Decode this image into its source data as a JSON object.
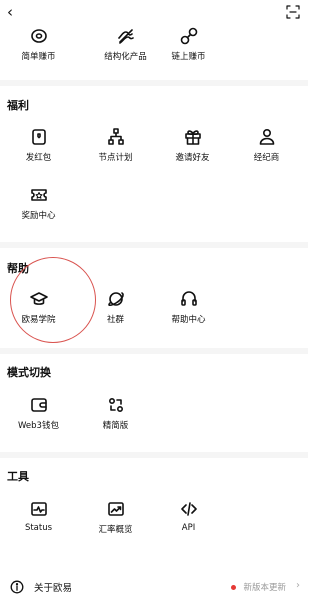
{
  "header": {
    "back_icon": "back-arrow-icon",
    "scan_icon": "scan-icon"
  },
  "top_items": [
    {
      "label": "简单赚币",
      "icon": "coin-target-icon"
    },
    {
      "label": "结构化产品",
      "icon": "structured-icon"
    },
    {
      "label": "链上赚币",
      "icon": "chain-icon"
    }
  ],
  "welfare": {
    "title": "福利",
    "items": [
      {
        "label": "发红包",
        "icon": "red-packet-icon"
      },
      {
        "label": "节点计划",
        "icon": "node-plan-icon"
      },
      {
        "label": "邀请好友",
        "icon": "gift-icon"
      },
      {
        "label": "经纪商",
        "icon": "broker-icon"
      },
      {
        "label": "奖励中心",
        "icon": "ticket-icon"
      }
    ]
  },
  "help": {
    "title": "帮助",
    "items": [
      {
        "label": "欧易学院",
        "icon": "graduation-cap-icon"
      },
      {
        "label": "社群",
        "icon": "planet-icon"
      },
      {
        "label": "帮助中心",
        "icon": "headset-icon"
      }
    ]
  },
  "mode": {
    "title": "模式切换",
    "items": [
      {
        "label": "Web3钱包",
        "icon": "wallet-icon"
      },
      {
        "label": "精简版",
        "icon": "switch-icon"
      }
    ]
  },
  "tools": {
    "title": "工具",
    "items": [
      {
        "label": "Status",
        "icon": "status-icon"
      },
      {
        "label": "汇率概览",
        "icon": "exchange-rate-icon"
      },
      {
        "label": "API",
        "icon": "code-icon"
      }
    ]
  },
  "about": {
    "label": "关于欧易",
    "update": "新版本更新",
    "accent": "#e53935"
  }
}
